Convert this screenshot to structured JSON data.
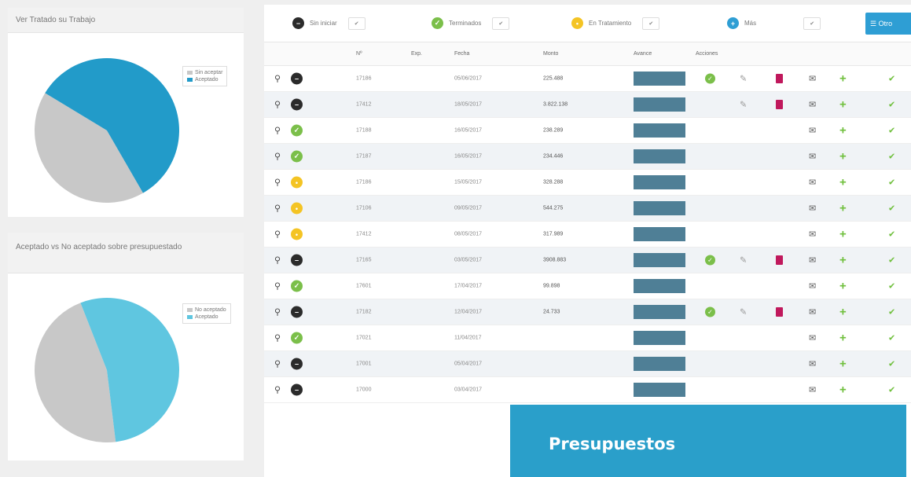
{
  "left_panels": [
    {
      "title": "Ver Tratado su Trabajo",
      "legend": [
        "Sin aceptar",
        "Aceptado"
      ],
      "slices": [
        {
          "label": "Sin aceptar",
          "value": 42,
          "color": "#c8c8c8"
        },
        {
          "label": "Aceptado",
          "value": 58,
          "color": "#229bc9"
        }
      ]
    },
    {
      "title": "Aceptado vs No aceptado sobre presupuestado",
      "legend": [
        "No aceptado",
        "Aceptado"
      ],
      "slices": [
        {
          "label": "No aceptado",
          "value": 46,
          "color": "#c8c8c8"
        },
        {
          "label": "Aceptado",
          "value": 54,
          "color": "#5fc6e0"
        }
      ]
    }
  ],
  "filters": [
    {
      "label": "Sin iniciar",
      "icon": "minus-circle-icon",
      "color": "#2b2b2b",
      "glyph": "−",
      "value": "✔"
    },
    {
      "label": "Terminados",
      "icon": "check-circle-icon",
      "color": "#7bbf4a",
      "glyph": "✓",
      "value": "✔"
    },
    {
      "label": "En Tratamiento",
      "icon": "clock-circle-icon",
      "color": "#f4c424",
      "glyph": "•",
      "value": "✔"
    },
    {
      "label": "Más",
      "icon": "plus-circle-icon",
      "color": "#2e9ed4",
      "glyph": "+",
      "value": "✔"
    }
  ],
  "list_button": {
    "label": "☰ Otro"
  },
  "columns": [
    "Nº",
    "Exp.",
    "Fecha",
    "Monto",
    "Avance",
    "Acciones"
  ],
  "status_styles": {
    "none": {
      "color": "#2b2b2b",
      "glyph": "−"
    },
    "done": {
      "color": "#7bbf4a",
      "glyph": "✓"
    },
    "wip": {
      "color": "#f4c424",
      "glyph": "•"
    }
  },
  "rows": [
    {
      "status": "none",
      "number": "17186",
      "date": "05/06/2017",
      "amount": "225.488",
      "actions": true
    },
    {
      "status": "none",
      "number": "17412",
      "date": "18/05/2017",
      "amount": "3.822.138",
      "actions": true,
      "no_ok": true
    },
    {
      "status": "done",
      "number": "17188",
      "date": "16/05/2017",
      "amount": "238.289",
      "actions": false
    },
    {
      "status": "done",
      "number": "17187",
      "date": "16/05/2017",
      "amount": "234.446",
      "actions": false
    },
    {
      "status": "wip",
      "number": "17186",
      "date": "15/05/2017",
      "amount": "328.288",
      "actions": false
    },
    {
      "status": "wip",
      "number": "17106",
      "date": "09/05/2017",
      "amount": "544.275",
      "actions": false
    },
    {
      "status": "wip",
      "number": "17412",
      "date": "08/05/2017",
      "amount": "317.989",
      "actions": false
    },
    {
      "status": "none",
      "number": "17165",
      "date": "03/05/2017",
      "amount": "3908.883",
      "actions": true
    },
    {
      "status": "done",
      "number": "17601",
      "date": "17/04/2017",
      "amount": "99.898",
      "actions": false
    },
    {
      "status": "none",
      "number": "17182",
      "date": "12/04/2017",
      "amount": "24.733",
      "actions": true
    },
    {
      "status": "done",
      "number": "17021",
      "date": "11/04/2017",
      "amount": "",
      "actions": false
    },
    {
      "status": "none",
      "number": "17001",
      "date": "05/04/2017",
      "amount": "",
      "actions": false
    },
    {
      "status": "none",
      "number": "17000",
      "date": "03/04/2017",
      "amount": "",
      "actions": false
    }
  ],
  "overlay": {
    "title": "Presupuestos"
  }
}
